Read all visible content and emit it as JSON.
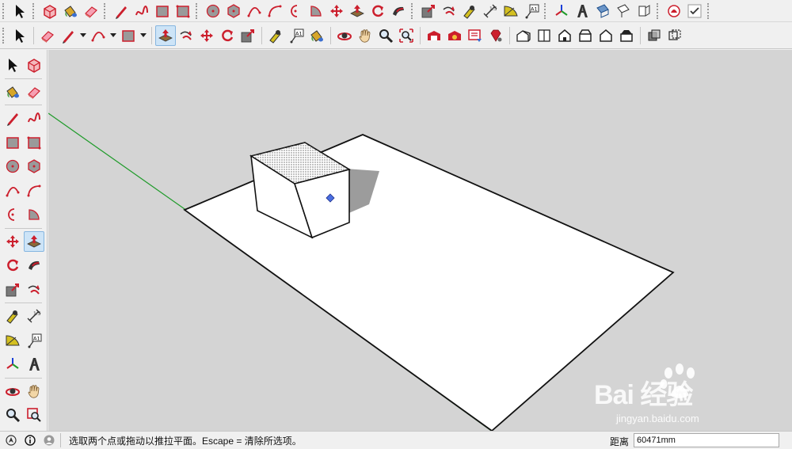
{
  "toolbar1": {
    "tools": [
      {
        "name": "select-tool",
        "icon": "arrow-cursor-icon"
      },
      {
        "name": "make-component-tool",
        "icon": "component-box-icon"
      },
      {
        "name": "paint-bucket-tool",
        "icon": "paint-bucket-icon"
      },
      {
        "name": "eraser-tool",
        "icon": "eraser-icon"
      },
      {
        "name": "line-tool",
        "icon": "pencil-icon"
      },
      {
        "name": "freehand-tool",
        "icon": "freehand-icon"
      },
      {
        "name": "rectangle-tool",
        "icon": "rectangle-icon"
      },
      {
        "name": "rotated-rectangle-tool",
        "icon": "rotated-rectangle-icon"
      },
      {
        "name": "circle-tool",
        "icon": "circle-icon"
      },
      {
        "name": "polygon-tool",
        "icon": "polygon-icon"
      },
      {
        "name": "arc-tool",
        "icon": "arc-icon"
      },
      {
        "name": "two-point-arc-tool",
        "icon": "two-point-arc-icon"
      },
      {
        "name": "three-point-arc-tool",
        "icon": "three-point-arc-icon"
      },
      {
        "name": "pie-tool",
        "icon": "pie-icon"
      },
      {
        "name": "move-tool",
        "icon": "move-icon"
      },
      {
        "name": "push-pull-tool",
        "icon": "push-pull-icon"
      },
      {
        "name": "rotate-tool",
        "icon": "rotate-icon"
      },
      {
        "name": "follow-me-tool",
        "icon": "follow-me-icon"
      },
      {
        "name": "scale-tool",
        "icon": "scale-icon"
      },
      {
        "name": "offset-tool",
        "icon": "offset-icon"
      },
      {
        "name": "tape-measure-tool",
        "icon": "tape-measure-icon"
      },
      {
        "name": "dimension-tool",
        "icon": "dimension-icon"
      },
      {
        "name": "protractor-tool",
        "icon": "protractor-icon"
      },
      {
        "name": "text-tool",
        "icon": "text-label-icon"
      },
      {
        "name": "axes-tool",
        "icon": "axes-icon"
      },
      {
        "name": "3d-text-tool",
        "icon": "3d-text-icon"
      },
      {
        "name": "section-plane-tool",
        "icon": "section-plane-icon"
      },
      {
        "name": "section-display-tool",
        "icon": "section-display-icon"
      },
      {
        "name": "section-fill-tool",
        "icon": "section-fill-icon"
      },
      {
        "name": "sandbox-tool",
        "icon": "sandbox-icon"
      },
      {
        "name": "checkbox-tool",
        "icon": "checkmark-icon"
      }
    ]
  },
  "toolbar2": {
    "tools": [
      {
        "name": "select-tool",
        "icon": "arrow-cursor-icon",
        "dropdown": false
      },
      {
        "name": "eraser-tool",
        "icon": "eraser-icon",
        "dropdown": false
      },
      {
        "name": "line-tool",
        "icon": "pencil-icon",
        "dropdown": true
      },
      {
        "name": "arc-tool",
        "icon": "arc-icon",
        "dropdown": true
      },
      {
        "name": "rectangle-tool",
        "icon": "rectangle-icon",
        "dropdown": true
      },
      {
        "name": "push-pull-tool",
        "icon": "push-pull-icon",
        "dropdown": false,
        "active": true
      },
      {
        "name": "offset-tool",
        "icon": "offset-icon",
        "dropdown": false
      },
      {
        "name": "move-tool",
        "icon": "move-icon",
        "dropdown": false
      },
      {
        "name": "rotate-tool",
        "icon": "rotate-icon",
        "dropdown": false
      },
      {
        "name": "scale-tool",
        "icon": "scale-icon",
        "dropdown": false
      },
      {
        "name": "tape-measure-tool",
        "icon": "tape-measure-icon",
        "dropdown": false
      },
      {
        "name": "text-tool",
        "icon": "text-label-icon",
        "dropdown": false
      },
      {
        "name": "paint-bucket-tool",
        "icon": "paint-bucket-icon",
        "dropdown": false
      },
      {
        "name": "orbit-tool",
        "icon": "orbit-icon",
        "dropdown": false
      },
      {
        "name": "pan-tool",
        "icon": "hand-icon",
        "dropdown": false
      },
      {
        "name": "zoom-tool",
        "icon": "magnifier-icon",
        "dropdown": false
      },
      {
        "name": "zoom-extents-tool",
        "icon": "zoom-extents-icon",
        "dropdown": false
      },
      {
        "name": "3d-warehouse-tool",
        "icon": "warehouse-icon",
        "dropdown": false
      },
      {
        "name": "extension-warehouse-tool",
        "icon": "extension-warehouse-icon",
        "dropdown": false
      },
      {
        "name": "share-model-tool",
        "icon": "share-model-icon",
        "dropdown": false
      },
      {
        "name": "extension-manager-tool",
        "icon": "ruby-gem-icon",
        "dropdown": false
      },
      {
        "name": "iso-view-tool",
        "icon": "iso-house-icon",
        "dropdown": false
      },
      {
        "name": "top-view-tool",
        "icon": "top-view-icon",
        "dropdown": false
      },
      {
        "name": "front-view-tool",
        "icon": "front-house-icon",
        "dropdown": false
      },
      {
        "name": "right-view-tool",
        "icon": "right-house-icon",
        "dropdown": false
      },
      {
        "name": "back-view-tool",
        "icon": "back-house-icon",
        "dropdown": false
      },
      {
        "name": "left-view-tool",
        "icon": "left-house-icon",
        "dropdown": false
      },
      {
        "name": "x-ray-tool",
        "icon": "x-ray-icon",
        "dropdown": false
      },
      {
        "name": "back-edges-tool",
        "icon": "back-edges-icon",
        "dropdown": false
      }
    ]
  },
  "left_toolbar": {
    "rows": [
      [
        "select-tool",
        "make-component-tool"
      ],
      [
        "paint-bucket-tool",
        "eraser-tool"
      ],
      [
        "line-tool",
        "freehand-tool"
      ],
      [
        "rectangle-tool",
        "rotated-rectangle-tool"
      ],
      [
        "circle-tool",
        "polygon-tool"
      ],
      [
        "arc-tool",
        "two-point-arc-tool"
      ],
      [
        "three-point-arc-tool",
        "pie-tool"
      ],
      [
        "move-tool",
        "push-pull-tool"
      ],
      [
        "rotate-tool",
        "follow-me-tool"
      ],
      [
        "scale-tool",
        "offset-tool"
      ],
      [
        "tape-measure-tool",
        "dimension-tool"
      ],
      [
        "protractor-tool",
        "text-tool"
      ],
      [
        "axes-tool",
        "3d-text-tool"
      ],
      [
        "orbit-tool",
        "pan-tool"
      ],
      [
        "zoom-tool",
        "zoom-window-tool"
      ]
    ]
  },
  "colors": {
    "viewport_bg": "#d4d4d4",
    "tool_red": "#cc1f2d",
    "active_tool_bg": "#cde4f7",
    "green_axis": "#1f9b2a",
    "face_white": "#ffffff",
    "shadow_gray": "#a0a0a0",
    "selection_blue": "#4a6ee0"
  },
  "status": {
    "text": "选取两个点或拖动以推拉平面。Escape = 清除所选项。",
    "measurement_label": "距离",
    "measurement_value": "60471mm"
  },
  "watermark": {
    "brand": "Bai 经验",
    "url": "jingyan.baidu.com"
  }
}
